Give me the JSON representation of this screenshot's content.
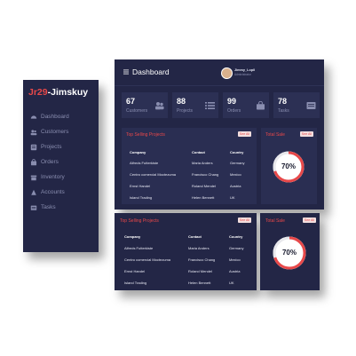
{
  "sidebar": {
    "brand_prefix": "Jr29",
    "brand_sep": "-",
    "brand_suffix": "Jimskuy",
    "items": [
      {
        "label": "Dashboard",
        "icon": "dashboard-icon"
      },
      {
        "label": "Customers",
        "icon": "users-icon"
      },
      {
        "label": "Projects",
        "icon": "clipboard-icon"
      },
      {
        "label": "Orders",
        "icon": "shopping-bag-icon"
      },
      {
        "label": "Inventory",
        "icon": "inventory-box-icon"
      },
      {
        "label": "Accounts",
        "icon": "user-icon"
      },
      {
        "label": "Tasks",
        "icon": "tasks-icon"
      }
    ]
  },
  "header": {
    "title": "Dashboard",
    "user_name": "Jimmy_Lopil",
    "user_role": "Administrator"
  },
  "stats": [
    {
      "value": "67",
      "label": "Customers",
      "icon": "users-icon"
    },
    {
      "value": "88",
      "label": "Projects",
      "icon": "list-icon"
    },
    {
      "value": "99",
      "label": "Orders",
      "icon": "shopping-bag-icon"
    },
    {
      "value": "78",
      "label": "Tasks",
      "icon": "tasks-icon"
    }
  ],
  "top_projects": {
    "title": "Top Selling Projects",
    "see_all": "See All",
    "columns": [
      "Company",
      "Contact",
      "Country"
    ],
    "rows": [
      [
        "Alfreds Futterkiste",
        "Maria Anders",
        "Germany"
      ],
      [
        "Centro comercial Moctezuma",
        "Francisco Chang",
        "Mexico"
      ],
      [
        "Ernst Handel",
        "Roland Mendel",
        "Austria"
      ],
      [
        "Island Trading",
        "Helen Bennett",
        "UK"
      ]
    ]
  },
  "total_sale": {
    "title": "Total Sale",
    "see_all": "See All",
    "percent_label": "70%",
    "percent": 70
  },
  "colors": {
    "panel": "#232646",
    "card": "#2a2e52",
    "accent": "#e84849",
    "ring_track": "#e8e8ec"
  }
}
